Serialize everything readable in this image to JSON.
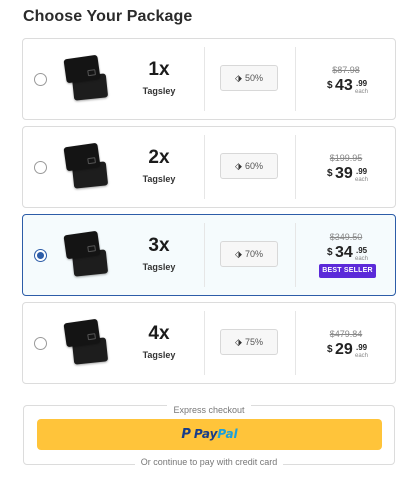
{
  "page": {
    "title": "Choose Your Package"
  },
  "packages": [
    {
      "quantity": "1x",
      "brand": "Tagsley",
      "discount": "50%",
      "old_price": "$87.98",
      "currency": "$",
      "price_whole": "43",
      "price_cents": ".99",
      "price_unit": "each",
      "selected": false,
      "badge": ""
    },
    {
      "quantity": "2x",
      "brand": "Tagsley",
      "discount": "60%",
      "old_price": "$199.95",
      "currency": "$",
      "price_whole": "39",
      "price_cents": ".99",
      "price_unit": "each",
      "selected": false,
      "badge": ""
    },
    {
      "quantity": "3x",
      "brand": "Tagsley",
      "discount": "70%",
      "old_price": "$349.50",
      "currency": "$",
      "price_whole": "34",
      "price_cents": ".95",
      "price_unit": "each",
      "selected": true,
      "badge": "BEST SELLER"
    },
    {
      "quantity": "4x",
      "brand": "Tagsley",
      "discount": "75%",
      "old_price": "$479.84",
      "currency": "$",
      "price_whole": "29",
      "price_cents": ".99",
      "price_unit": "each",
      "selected": false,
      "badge": ""
    }
  ],
  "checkout": {
    "legend": "Express checkout",
    "paypal_pay": "Pay",
    "paypal_pal": "Pal",
    "paypal_glyph": "P",
    "footer": "Or continue to pay with credit card"
  },
  "colors": {
    "accent": "#2d5da8",
    "badge": "#5b2ad9",
    "paypal_button": "#ffc43a",
    "paypal_dark": "#173d8a",
    "paypal_light": "#1da0da"
  },
  "icons": {
    "discount": "tag-icon",
    "product": "card-image"
  }
}
